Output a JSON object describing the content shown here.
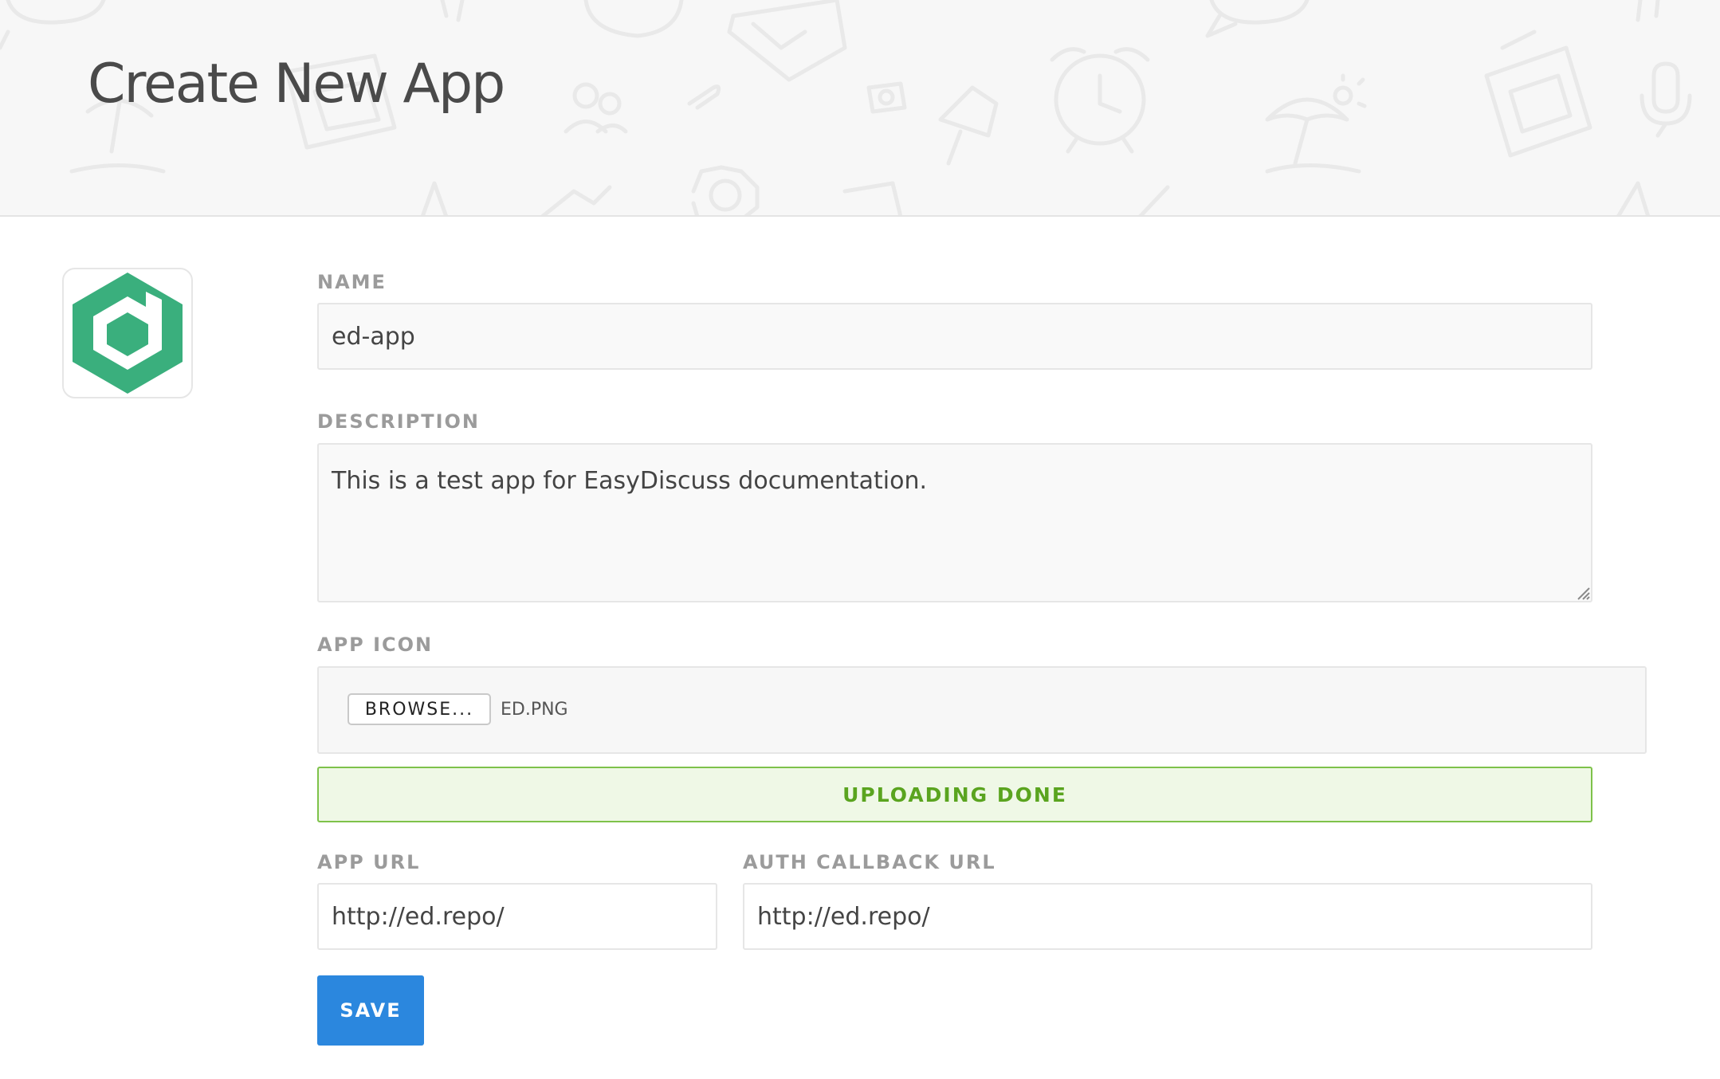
{
  "header": {
    "title": "Create New App"
  },
  "logo": {
    "icon": "easydiscuss-hexagon-icon",
    "color": "#3aaf7d"
  },
  "form": {
    "name": {
      "label": "NAME",
      "value": "ed-app"
    },
    "description": {
      "label": "DESCRIPTION",
      "value": "This is a test app for EasyDiscuss documentation."
    },
    "app_icon": {
      "label": "APP ICON",
      "browse_label": "BROWSE...",
      "file_name": "ED.PNG"
    },
    "upload_status": {
      "text": "UPLOADING DONE",
      "color": "#5aa41f"
    },
    "app_url": {
      "label": "APP URL",
      "value": "http://ed.repo/"
    },
    "auth_callback_url": {
      "label": "AUTH CALLBACK URL",
      "value": "http://ed.repo/"
    },
    "save_label": "SAVE"
  },
  "colors": {
    "primary_button": "#2b87de",
    "success_border": "#7ec24a",
    "success_background": "#eff8e6"
  }
}
